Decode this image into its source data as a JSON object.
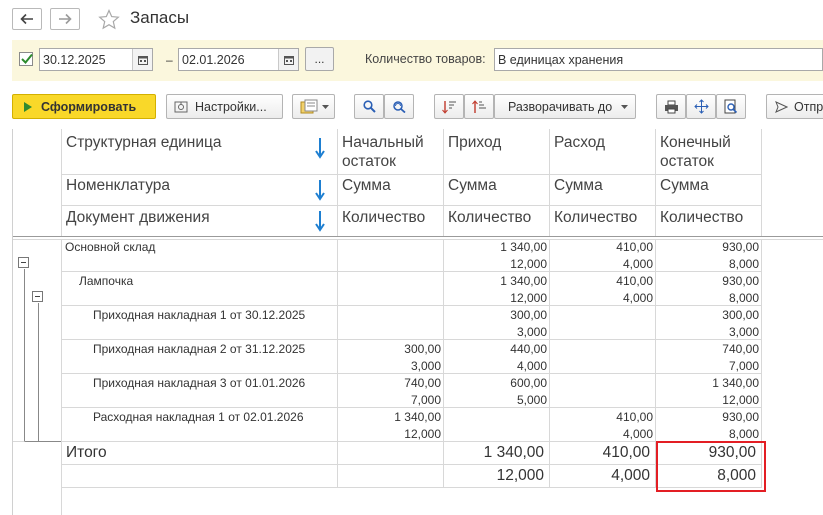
{
  "window": {
    "title": "Запасы",
    "back_icon": "arrow-left-icon",
    "forward_icon": "arrow-right-icon",
    "favorite_icon": "star-icon"
  },
  "filters": {
    "period_enabled": true,
    "date_from": "30.12.2025",
    "separator": "–",
    "date_to": "02.01.2026",
    "dots_label": "...",
    "qty_label": "Количество товаров:",
    "qty_value": "В единицах хранения"
  },
  "toolbar": {
    "generate_label": "Сформировать",
    "settings_label": "Настройки...",
    "expand_label": "Разворачивать до",
    "send_label": "Отпр"
  },
  "report": {
    "headers": {
      "group_rows": [
        "Структурная единица",
        "Номенклатура",
        "Документ движения"
      ],
      "opening": "Начальный остаток",
      "income": "Приход",
      "expense": "Расход",
      "closing": "Конечный остаток",
      "sum": "Сумма",
      "qty": "Количество"
    },
    "rows": [
      {
        "label": "Основной склад",
        "sum": [
          "",
          "1 340,00",
          "410,00",
          "930,00"
        ],
        "qty": [
          "",
          "12,000",
          "4,000",
          "8,000"
        ]
      },
      {
        "label": "Лампочка",
        "sum": [
          "",
          "1 340,00",
          "410,00",
          "930,00"
        ],
        "qty": [
          "",
          "12,000",
          "4,000",
          "8,000"
        ]
      },
      {
        "label": "Приходная накладная 1 от 30.12.2025",
        "sum": [
          "",
          "300,00",
          "",
          "300,00"
        ],
        "qty": [
          "",
          "3,000",
          "",
          "3,000"
        ]
      },
      {
        "label": "Приходная накладная 2 от 31.12.2025",
        "sum": [
          "300,00",
          "440,00",
          "",
          "740,00"
        ],
        "qty": [
          "3,000",
          "4,000",
          "",
          "7,000"
        ]
      },
      {
        "label": "Приходная накладная 3 от 01.01.2026",
        "sum": [
          "740,00",
          "600,00",
          "",
          "1 340,00"
        ],
        "qty": [
          "7,000",
          "5,000",
          "",
          "12,000"
        ]
      },
      {
        "label": "Расходная накладная 1 от 02.01.2026",
        "sum": [
          "1 340,00",
          "",
          "410,00",
          "930,00"
        ],
        "qty": [
          "12,000",
          "",
          "4,000",
          "8,000"
        ]
      }
    ],
    "total": {
      "label": "Итого",
      "sum": [
        "",
        "1 340,00",
        "410,00",
        "930,00"
      ],
      "qty": [
        "",
        "12,000",
        "4,000",
        "8,000"
      ]
    },
    "highlight_color": "#e31e24"
  }
}
